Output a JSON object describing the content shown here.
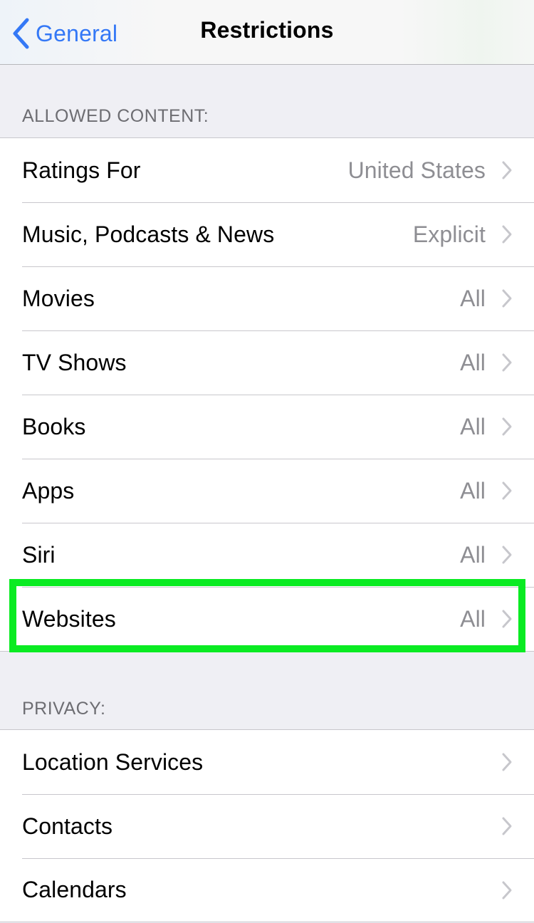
{
  "navbar": {
    "back_label": "General",
    "back_icon": "chevron-left-icon",
    "title": "Restrictions"
  },
  "sections": [
    {
      "header": "ALLOWED CONTENT:",
      "rows": [
        {
          "label": "Ratings For",
          "value": "United States",
          "icon": "chevron-right-icon"
        },
        {
          "label": "Music, Podcasts & News",
          "value": "Explicit",
          "icon": "chevron-right-icon"
        },
        {
          "label": "Movies",
          "value": "All",
          "icon": "chevron-right-icon"
        },
        {
          "label": "TV Shows",
          "value": "All",
          "icon": "chevron-right-icon"
        },
        {
          "label": "Books",
          "value": "All",
          "icon": "chevron-right-icon"
        },
        {
          "label": "Apps",
          "value": "All",
          "icon": "chevron-right-icon"
        },
        {
          "label": "Siri",
          "value": "All",
          "icon": "chevron-right-icon"
        },
        {
          "label": "Websites",
          "value": "All",
          "icon": "chevron-right-icon",
          "highlighted": true
        }
      ]
    },
    {
      "header": "PRIVACY:",
      "rows": [
        {
          "label": "Location Services",
          "value": "",
          "icon": "chevron-right-icon"
        },
        {
          "label": "Contacts",
          "value": "",
          "icon": "chevron-right-icon"
        },
        {
          "label": "Calendars",
          "value": "",
          "icon": "chevron-right-icon"
        }
      ]
    }
  ],
  "colors": {
    "accent": "#3478f6",
    "highlight": "#0aeb22",
    "secondary_text": "#8e8e93",
    "grouped_background": "#efeff4"
  }
}
